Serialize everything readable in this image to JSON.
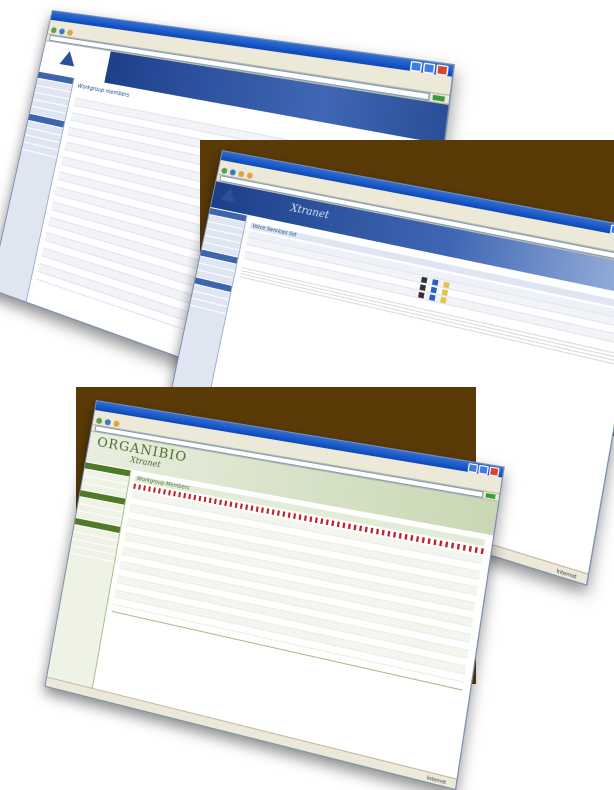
{
  "screens": {
    "back": {
      "title_bar": "",
      "address": "",
      "page_heading": "Workgroup members",
      "sub_heading": "",
      "link_right": "",
      "columns": [
        "",
        "",
        ""
      ],
      "sidebar_items": [],
      "rows": []
    },
    "middle": {
      "title_bar": "",
      "address": "",
      "banner_title": "Xtranet",
      "page_heading": "Voice Services list",
      "table_header": "",
      "rows": [],
      "status_text": "Internet"
    },
    "front": {
      "title_bar": "",
      "address": "",
      "brand_title": "ORGANIBIO",
      "brand_sub": "Xtranet",
      "page_heading": "Workgroup Members",
      "rows": [],
      "footer": "",
      "status_text": "Internet"
    }
  },
  "colors": {
    "backdrop": "#5a3a07",
    "xtranet_blue": "#1d3f8a",
    "organibio_green": "#4c6a2b",
    "link_red": "#c4202a"
  }
}
